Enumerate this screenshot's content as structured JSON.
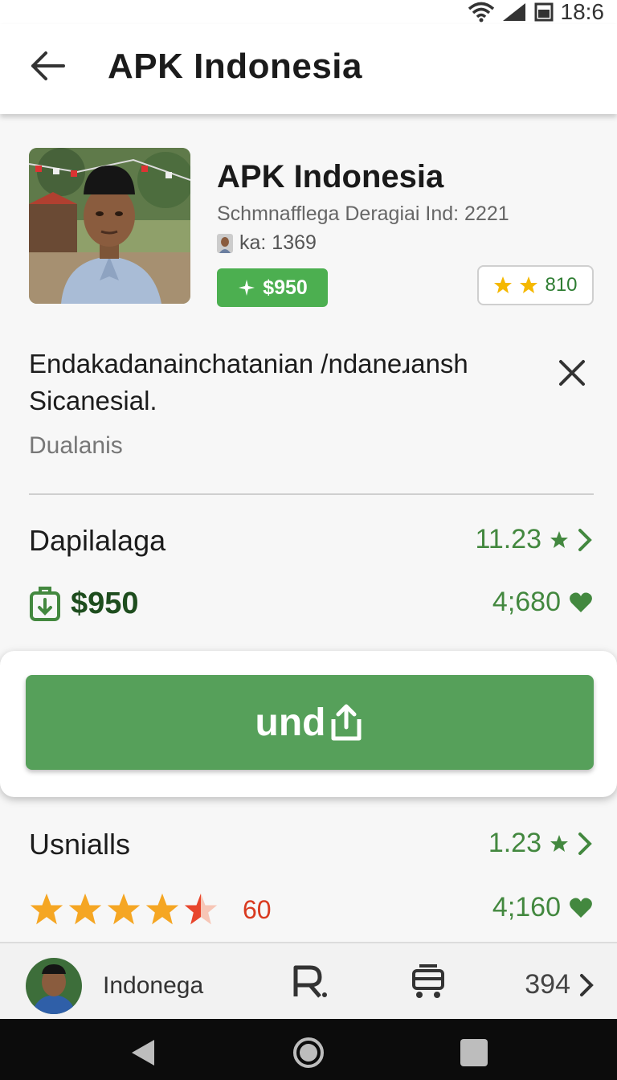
{
  "status_bar": {
    "time": "18:6",
    "icons": [
      "wifi-icon",
      "signal-icon",
      "battery-icon"
    ]
  },
  "app_bar": {
    "title": "APK  Indonesia",
    "back_icon": "arrow-left-icon"
  },
  "app_info": {
    "name": "APK Indonesia",
    "developer": "Schmnafflega Deragiai Ind: 2221",
    "meta": "ka: 1369",
    "price_badge": "$950",
    "rating_badge": "810"
  },
  "description": {
    "text": "Endakadanainchatanian /ndaneɹansh Sicanesial.",
    "sub": "Dualanis"
  },
  "rows": {
    "section1_label": "Dapilalaga",
    "section1_value": "11.23",
    "price": "$950",
    "price_right": "4;680",
    "section2_label": "Usnialls",
    "section2_value": "1.23",
    "rating_count": "60",
    "rating_right": "4;160"
  },
  "cta": {
    "label": "und"
  },
  "bottom_bar": {
    "profile_name": "Indonega",
    "count": "394"
  },
  "colors": {
    "accent": "#56a05a",
    "badge": "#4caf50",
    "value_green": "#43883f",
    "star": "#f5a623",
    "rating_red": "#d93a1f"
  }
}
